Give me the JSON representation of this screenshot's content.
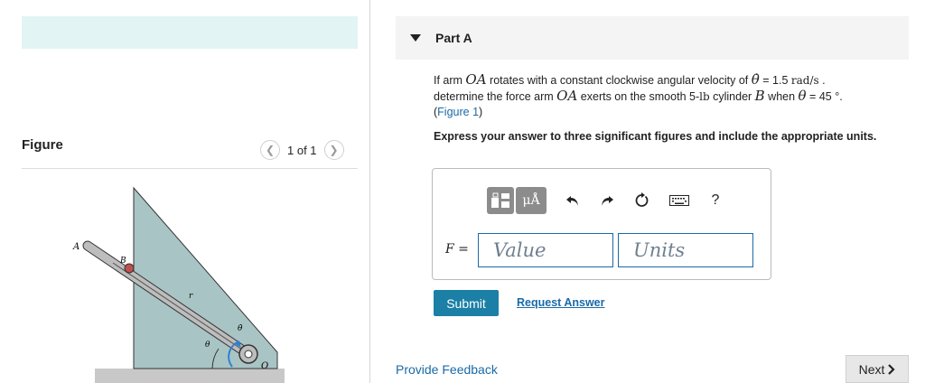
{
  "left_panel": {
    "figure_title": "Figure",
    "pager": {
      "prev_icon": "chevron-left-icon",
      "next_icon": "chevron-right-icon",
      "label": "1 of 1"
    },
    "figure_labels": {
      "A": "A",
      "B": "B",
      "O": "O",
      "r": "r",
      "theta": "θ",
      "theta_dot": "θ̇"
    }
  },
  "part": {
    "title": "Part A",
    "question": {
      "t1": "If arm ",
      "oa": "OA",
      "t2": " rotates with a constant clockwise angular velocity of ",
      "thetadot": "θ̇",
      "t3": " = 1.5 ",
      "unit": "rad/s",
      "t4": " .",
      "t5": "determine the force arm ",
      "oa2": "OA",
      "t6": " exerts on the smooth 5-",
      "lb": "lb",
      "t7": " cylinder ",
      "b": "B",
      "t8": " when ",
      "theta": "θ",
      "t9": " = 45 °.",
      "figure_link": "Figure 1",
      "open_paren": "(",
      "close_paren": ")"
    },
    "instruction": "Express your answer to three significant figures and include the appropriate units."
  },
  "answer": {
    "f_label": "F =",
    "value_placeholder": "Value",
    "units_placeholder": "Units",
    "toolbar": {
      "templates_icon": "templates-icon",
      "units_label": "μÅ",
      "undo_icon": "undo-icon",
      "redo_icon": "redo-icon",
      "reset_icon": "reset-icon",
      "keyboard_icon": "keyboard-icon",
      "help_label": "?"
    }
  },
  "buttons": {
    "submit": "Submit",
    "request_answer": "Request Answer",
    "provide_feedback": "Provide Feedback",
    "next": "Next"
  },
  "colors": {
    "accent": "#1b7fa6",
    "link": "#1a6aa6",
    "banner": "#e2f4f4",
    "figure_fill": "#a9c4c5"
  }
}
